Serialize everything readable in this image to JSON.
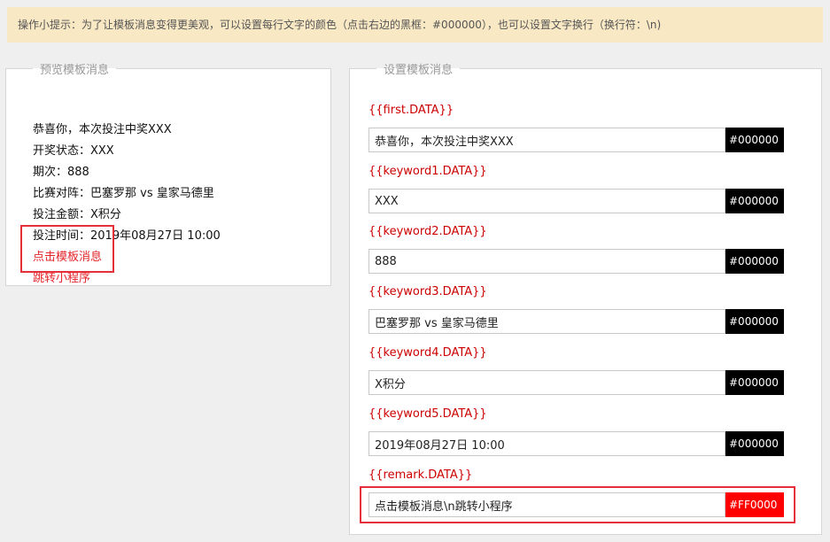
{
  "tip": "操作小提示：为了让模板消息变得更美观，可以设置每行文字的颜色（点击右边的黑框：#000000），也可以设置文字换行（换行符：\\n)",
  "preview": {
    "legend": "预览模板消息",
    "lines": [
      "恭喜你，本次投注中奖XXX",
      "开奖状态：XXX",
      "期次：888",
      "比赛对阵：巴塞罗那 vs 皇家马德里",
      "投注金额：X积分",
      "投注时间：2019年08月27日 10:00",
      "点击模板消息",
      "跳转小程序"
    ]
  },
  "settings": {
    "legend": "设置模板消息",
    "fields": [
      {
        "label": "{{first.DATA}}",
        "value": "恭喜你，本次投注中奖XXX",
        "color": "#000000"
      },
      {
        "label": "{{keyword1.DATA}}",
        "value": "XXX",
        "color": "#000000"
      },
      {
        "label": "{{keyword2.DATA}}",
        "value": "888",
        "color": "#000000"
      },
      {
        "label": "{{keyword3.DATA}}",
        "value": "巴塞罗那 vs 皇家马德里",
        "color": "#000000"
      },
      {
        "label": "{{keyword4.DATA}}",
        "value": "X积分",
        "color": "#000000"
      },
      {
        "label": "{{keyword5.DATA}}",
        "value": "2019年08月27日 10:00",
        "color": "#000000"
      },
      {
        "label": "{{remark.DATA}}",
        "value": "点击模板消息\\n跳转小程序",
        "color": "#FF0000"
      }
    ]
  }
}
